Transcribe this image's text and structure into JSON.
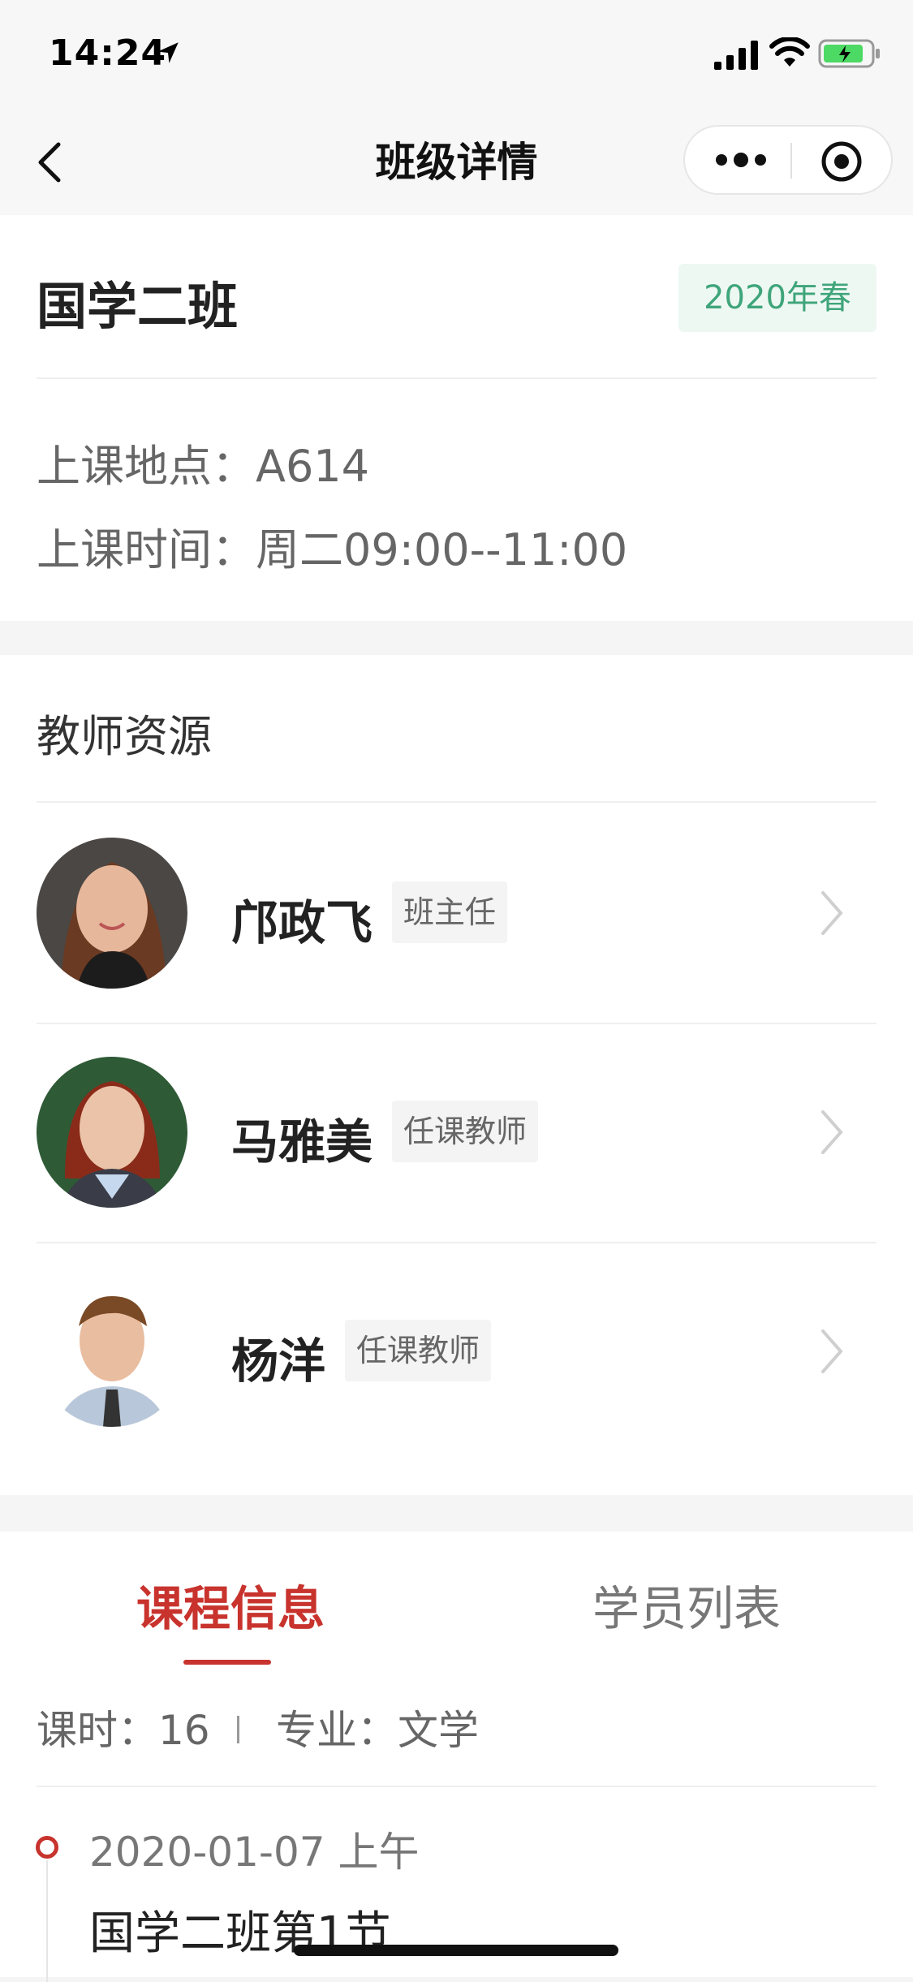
{
  "status_bar": {
    "time": "14:24"
  },
  "nav": {
    "title": "班级详情"
  },
  "class_info": {
    "name": "国学二班",
    "term": "2020年春",
    "location_label": "上课地点：",
    "location": "A614",
    "time_label": "上课时间：",
    "time": "周二09:00--11:00"
  },
  "teachers": {
    "title": "教师资源",
    "items": [
      {
        "name": "邝政飞",
        "role": "班主任"
      },
      {
        "name": "马雅美",
        "role": "任课教师"
      },
      {
        "name": "杨洋",
        "role": "任课教师"
      }
    ]
  },
  "tabs": [
    {
      "label": "课程信息"
    },
    {
      "label": "学员列表"
    }
  ],
  "course": {
    "hours_label": "课时：",
    "hours": "16",
    "major_label": "专业：",
    "major": "文学",
    "lessons": [
      {
        "date": "2020-01-07 上午",
        "title": "国学二班第1节"
      }
    ]
  },
  "colors": {
    "accent": "#c8332d",
    "term_badge": "#3fa57a"
  }
}
